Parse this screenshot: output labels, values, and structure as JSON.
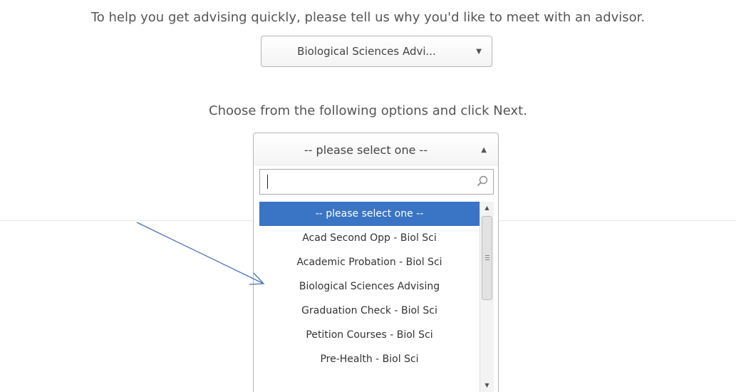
{
  "intro": {
    "text": "To help you get advising quickly, please tell us why you'd like to meet with an advisor."
  },
  "category_select": {
    "value": "Biological Sciences Advi..."
  },
  "prompt": {
    "text": "Choose from the following options and click Next."
  },
  "reason_select": {
    "value": "-- please select one --",
    "search": {
      "value": "",
      "icon": "search-icon"
    },
    "options": [
      {
        "label": "-- please select one --"
      },
      {
        "label": "Acad Second Opp - Biol Sci"
      },
      {
        "label": "Academic Probation - Biol Sci"
      },
      {
        "label": "Biological Sciences Advising"
      },
      {
        "label": "Graduation Check - Biol Sci"
      },
      {
        "label": "Petition Courses - Biol Sci"
      },
      {
        "label": "Pre-Health - Biol Sci"
      }
    ]
  },
  "colors": {
    "highlight": "#3a74c4",
    "annotation_arrow": "#4a73b8"
  }
}
